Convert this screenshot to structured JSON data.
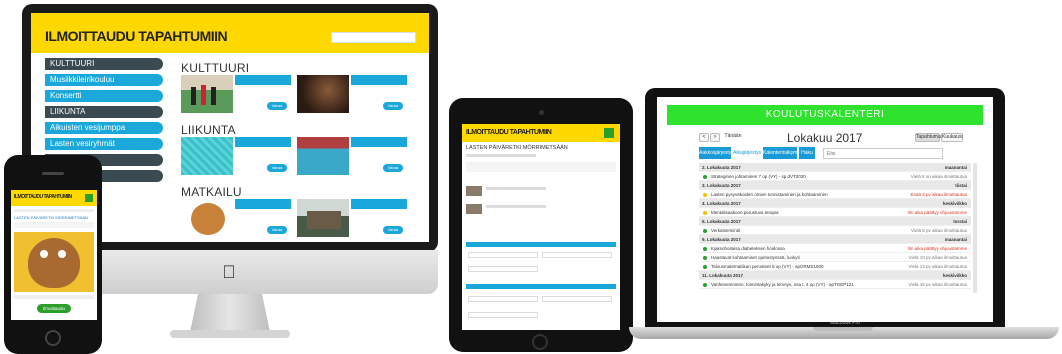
{
  "imac": {
    "site_title": "ILMOITTAUDU TAPAHTUMIIN",
    "sidebar": [
      {
        "label": "KULTTUURI",
        "kind": "cat"
      },
      {
        "label": "Musiikkileirikouluu",
        "kind": "sub"
      },
      {
        "label": "Konsertti",
        "kind": "sub"
      },
      {
        "label": "LIIKUNTA",
        "kind": "cat"
      },
      {
        "label": "Aikuisten vesijumppa",
        "kind": "sub"
      },
      {
        "label": "Lasten vesiryhmät",
        "kind": "sub"
      },
      {
        "label": "MATKAILU",
        "kind": "cat"
      },
      {
        "label": "KURSSIT",
        "kind": "cat"
      }
    ],
    "sections": [
      {
        "title": "KULTTUURI"
      },
      {
        "title": "LIIKUNTA"
      },
      {
        "title": "MATKAILU"
      }
    ],
    "card_button": "Varaa",
    "apple_logo": ""
  },
  "phone": {
    "site_title": "ILMOITTAUDU TAPAHTUMIIN",
    "event_title": "LASTEN PÄIVÄRETKI MÖRRIMETSÄÄN",
    "cta": "Ilmoittaudu"
  },
  "tablet": {
    "site_title": "ILMOITTAUDU TAPAHTUMIIN",
    "event_title": "LASTEN PÄIVÄRETKI MÖRRIMETSÄÄN"
  },
  "macbook": {
    "calendar_title": "KOULUTUSKALENTERI",
    "prev_label": "<",
    "next_label": ">",
    "today_label": "Tänään",
    "month_title": "Lokakuu 2017",
    "view_buttons": [
      "Tapahtumat",
      "Kuukausi"
    ],
    "tabs": [
      "Aakkosjärjestys",
      "Aikajärjestys",
      "Kalenterinäkymä",
      "Haku"
    ],
    "search_placeholder": "Etsi",
    "rows": [
      {
        "kind": "day",
        "text": "2. Lokakuuta 2017",
        "right": "maanantai"
      },
      {
        "kind": "item",
        "dot": "#2c9e2c",
        "text": "Strateginen johtaminen 7 op (VY) - sp.dVT2020",
        "right": "Vielä 8 on aikaa ilmoittautua",
        "red": false
      },
      {
        "kind": "day",
        "text": "3. Lokakuuta 2017",
        "right": "tiistai"
      },
      {
        "kind": "item",
        "dot": "#f2c200",
        "text": "Lasten pysyväkoiden omien tunnistaminen ja kohtaaminen",
        "right": "Enää 3 pv aikaa ilmoittautua",
        "red": true
      },
      {
        "kind": "day",
        "text": "4. Lokakuuta 2017",
        "right": "keskiviikko"
      },
      {
        "kind": "item",
        "dot": "#f2c200",
        "text": "Mentalisaatioon perustuva terapia",
        "right": "Ilm.aika päättyy ohjuustamme",
        "red": true
      },
      {
        "kind": "day",
        "text": "5. Lokakuuta 2017",
        "right": "torstai"
      },
      {
        "kind": "item",
        "dot": "#2c9e2c",
        "text": "Verkatsemiintit",
        "right": "Vielä 5 pv aikaa ilmoittautua",
        "red": false
      },
      {
        "kind": "day",
        "text": "9. Lokakuuta 2017",
        "right": "maanantai"
      },
      {
        "kind": "item",
        "dot": "#2c9e2c",
        "text": "Kjaksohoitaisa diabeteksen hoidossa",
        "right": "Ilm.aika päättyy ohjuustamme",
        "red": true
      },
      {
        "kind": "item",
        "dot": "#2c9e2c",
        "text": "Haastavat kohtaamiset opetustyössä, luokyti",
        "right": "Vielä 10 pv aikaa ilmoittautua",
        "red": false
      },
      {
        "kind": "item",
        "dot": "#2c9e2c",
        "text": "Talousmatematiikan perusteet 5 op (VY) - apGRMS1500",
        "right": "Vielä 13 pv aikaa ilmoittautua",
        "red": false
      },
      {
        "kind": "day",
        "text": "11. Lokakuuta 2017",
        "right": "keskiviikko"
      },
      {
        "kind": "item",
        "dot": "#2c9e2c",
        "text": "Vanhenemninen, toimintakyky ja terveys, osa I, 4 op (VY) - apTGEP121",
        "right": "Vielä 16 pv aikaa ilmoittautua",
        "red": false
      }
    ],
    "brand_label": "MacBook Pro"
  }
}
